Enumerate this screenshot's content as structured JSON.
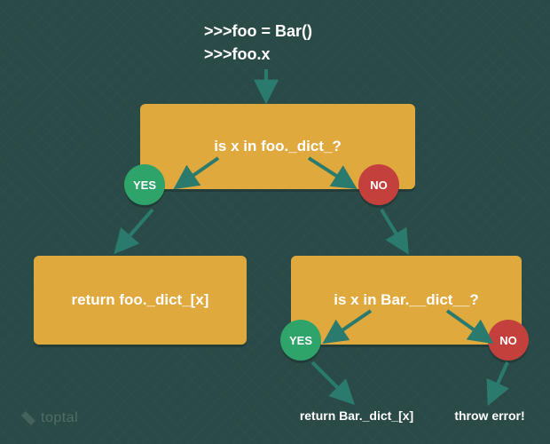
{
  "code": {
    "line1": ">>>foo = Bar()",
    "line2": ">>>foo.x"
  },
  "box1": {
    "label": "is x in foo._dict_?"
  },
  "box2": {
    "label": "return foo._dict_[x]"
  },
  "box3": {
    "label": "is x in Bar.__dict__?"
  },
  "badges": {
    "yes": "YES",
    "no": "NO"
  },
  "result1": "return Bar._dict_[x]",
  "result2": "throw error!",
  "watermark": "toptal",
  "colors": {
    "bg": "#2a4a47",
    "box": "#e0a93e",
    "yes": "#2ea36a",
    "no": "#c4403d",
    "arrow": "#2a7a6e"
  }
}
